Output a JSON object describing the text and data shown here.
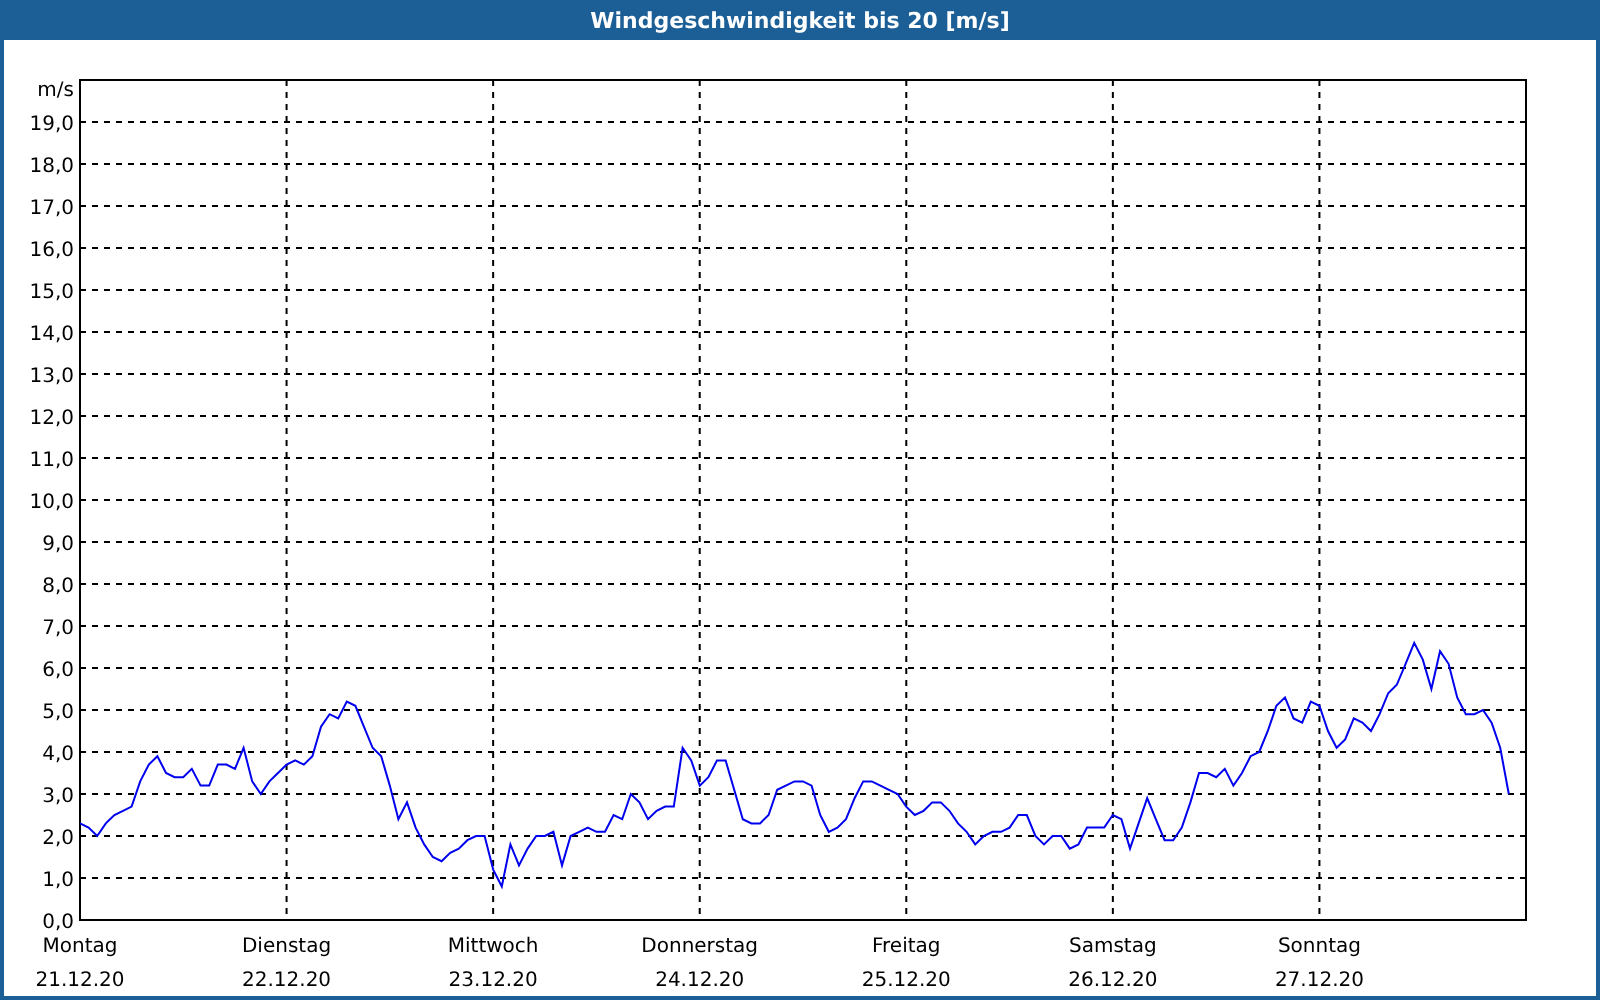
{
  "window": {
    "title": "Windgeschwindigkeit bis 20 [m/s]"
  },
  "chart": {
    "dates": [
      "21.12.20",
      "22.12.20",
      "23.12.20",
      "24.12.20",
      "25.12.20",
      "26.12.20",
      "27.12.20"
    ],
    "chart_data": {
      "type": "line",
      "grid": true,
      "ylabel": "m/s",
      "ylim": [
        0,
        20
      ],
      "yticks": [
        {
          "value": 0,
          "label": "0,0"
        },
        {
          "value": 1,
          "label": "1,0"
        },
        {
          "value": 2,
          "label": "2,0"
        },
        {
          "value": 3,
          "label": "3,0"
        },
        {
          "value": 4,
          "label": "4,0"
        },
        {
          "value": 5,
          "label": "5,0"
        },
        {
          "value": 6,
          "label": "6,0"
        },
        {
          "value": 7,
          "label": "7,0"
        },
        {
          "value": 8,
          "label": "8,0"
        },
        {
          "value": 9,
          "label": "9,0"
        },
        {
          "value": 10,
          "label": "10,0"
        },
        {
          "value": 11,
          "label": "11,0"
        },
        {
          "value": 12,
          "label": "12,0"
        },
        {
          "value": 13,
          "label": "13,0"
        },
        {
          "value": 14,
          "label": "14,0"
        },
        {
          "value": 15,
          "label": "15,0"
        },
        {
          "value": 16,
          "label": "16,0"
        },
        {
          "value": 17,
          "label": "17,0"
        },
        {
          "value": 18,
          "label": "18,0"
        },
        {
          "value": 19,
          "label": "19,0"
        }
      ],
      "categories": [
        "Montag",
        null,
        null,
        null,
        null,
        null,
        null,
        null,
        null,
        null,
        null,
        null,
        null,
        null,
        null,
        null,
        null,
        null,
        null,
        null,
        null,
        null,
        null,
        null,
        "Dienstag",
        null,
        null,
        null,
        null,
        null,
        null,
        null,
        null,
        null,
        null,
        null,
        null,
        null,
        null,
        null,
        null,
        null,
        null,
        null,
        null,
        null,
        null,
        null,
        "Mittwoch",
        null,
        null,
        null,
        null,
        null,
        null,
        null,
        null,
        null,
        null,
        null,
        null,
        null,
        null,
        null,
        null,
        null,
        null,
        null,
        null,
        null,
        null,
        null,
        "Donnerstag",
        null,
        null,
        null,
        null,
        null,
        null,
        null,
        null,
        null,
        null,
        null,
        null,
        null,
        null,
        null,
        null,
        null,
        null,
        null,
        null,
        null,
        null,
        null,
        "Freitag",
        null,
        null,
        null,
        null,
        null,
        null,
        null,
        null,
        null,
        null,
        null,
        null,
        null,
        null,
        null,
        null,
        null,
        null,
        null,
        null,
        null,
        null,
        null,
        "Samstag",
        null,
        null,
        null,
        null,
        null,
        null,
        null,
        null,
        null,
        null,
        null,
        null,
        null,
        null,
        null,
        null,
        null,
        null,
        null,
        null,
        null,
        null,
        null,
        "Sonntag",
        null,
        null,
        null,
        null,
        null,
        null,
        null,
        null,
        null,
        null,
        null,
        null,
        null,
        null,
        null,
        null,
        null,
        null,
        null,
        null,
        null,
        null
      ],
      "series": [
        {
          "color": "#0000ee",
          "values": [
            2.3,
            2.2,
            2.0,
            2.3,
            2.5,
            2.6,
            2.7,
            3.3,
            3.7,
            3.9,
            3.5,
            3.4,
            3.4,
            3.6,
            3.2,
            3.2,
            3.7,
            3.7,
            3.6,
            4.1,
            3.3,
            3.0,
            3.3,
            3.5,
            3.7,
            3.8,
            3.7,
            3.9,
            4.6,
            4.9,
            4.8,
            5.2,
            5.1,
            4.6,
            4.1,
            3.9,
            3.2,
            2.4,
            2.8,
            2.2,
            1.8,
            1.5,
            1.4,
            1.6,
            1.7,
            1.9,
            2.0,
            2.0,
            1.2,
            0.8,
            1.8,
            1.3,
            1.7,
            2.0,
            2.0,
            2.1,
            1.3,
            2.0,
            2.1,
            2.2,
            2.1,
            2.1,
            2.5,
            2.4,
            3.0,
            2.8,
            2.4,
            2.6,
            2.7,
            2.7,
            4.1,
            3.8,
            3.2,
            3.4,
            3.8,
            3.8,
            3.1,
            2.4,
            2.3,
            2.3,
            2.5,
            3.1,
            3.2,
            3.3,
            3.3,
            3.2,
            2.5,
            2.1,
            2.2,
            2.4,
            2.9,
            3.3,
            3.3,
            3.2,
            3.1,
            3.0,
            2.7,
            2.5,
            2.6,
            2.8,
            2.8,
            2.6,
            2.3,
            2.1,
            1.8,
            2.0,
            2.1,
            2.1,
            2.2,
            2.5,
            2.5,
            2.0,
            1.8,
            2.0,
            2.0,
            1.7,
            1.8,
            2.2,
            2.2,
            2.2,
            2.5,
            2.4,
            1.7,
            2.3,
            2.9,
            2.4,
            1.9,
            1.9,
            2.2,
            2.8,
            3.5,
            3.5,
            3.4,
            3.6,
            3.2,
            3.5,
            3.9,
            4.0,
            4.5,
            5.1,
            5.3,
            4.8,
            4.7,
            5.2,
            5.1,
            4.5,
            4.1,
            4.3,
            4.8,
            4.7,
            4.5,
            4.9,
            5.4,
            5.6,
            6.1,
            6.6,
            6.2,
            5.5,
            6.4,
            6.1,
            5.3,
            4.9,
            4.9,
            5.0,
            4.7,
            4.1,
            3.0
          ]
        }
      ]
    }
  }
}
